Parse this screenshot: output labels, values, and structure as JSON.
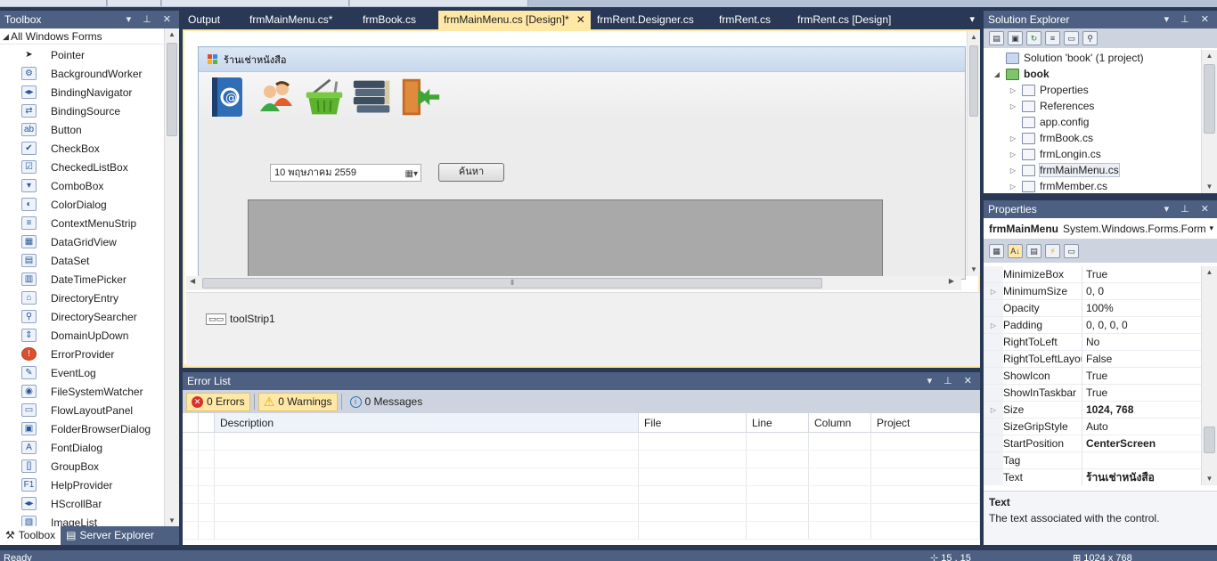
{
  "toolbox": {
    "title": "Toolbox",
    "group": "All Windows Forms",
    "items": [
      {
        "label": "Pointer",
        "icon": "pointer-icon",
        "glyph": "➤"
      },
      {
        "label": "BackgroundWorker",
        "icon": "background-worker-icon",
        "glyph": "⚙"
      },
      {
        "label": "BindingNavigator",
        "icon": "binding-navigator-icon",
        "glyph": "◂▸"
      },
      {
        "label": "BindingSource",
        "icon": "binding-source-icon",
        "glyph": "⇄"
      },
      {
        "label": "Button",
        "icon": "button-icon",
        "glyph": "ab"
      },
      {
        "label": "CheckBox",
        "icon": "checkbox-icon",
        "glyph": "✔"
      },
      {
        "label": "CheckedListBox",
        "icon": "checked-listbox-icon",
        "glyph": "☑"
      },
      {
        "label": "ComboBox",
        "icon": "combobox-icon",
        "glyph": "▾"
      },
      {
        "label": "ColorDialog",
        "icon": "color-dialog-icon",
        "glyph": "◐"
      },
      {
        "label": "ContextMenuStrip",
        "icon": "context-menu-icon",
        "glyph": "≡"
      },
      {
        "label": "DataGridView",
        "icon": "datagridview-icon",
        "glyph": "▦"
      },
      {
        "label": "DataSet",
        "icon": "dataset-icon",
        "glyph": "▤"
      },
      {
        "label": "DateTimePicker",
        "icon": "datetimepicker-icon",
        "glyph": "▥"
      },
      {
        "label": "DirectoryEntry",
        "icon": "directory-entry-icon",
        "glyph": "⌂"
      },
      {
        "label": "DirectorySearcher",
        "icon": "directory-searcher-icon",
        "glyph": "⚲"
      },
      {
        "label": "DomainUpDown",
        "icon": "domain-updown-icon",
        "glyph": "⇕"
      },
      {
        "label": "ErrorProvider",
        "icon": "error-provider-icon",
        "glyph": "!"
      },
      {
        "label": "EventLog",
        "icon": "eventlog-icon",
        "glyph": "✎"
      },
      {
        "label": "FileSystemWatcher",
        "icon": "filesystem-watcher-icon",
        "glyph": "◉"
      },
      {
        "label": "FlowLayoutPanel",
        "icon": "flowlayout-panel-icon",
        "glyph": "▭"
      },
      {
        "label": "FolderBrowserDialog",
        "icon": "folder-browser-icon",
        "glyph": "▣"
      },
      {
        "label": "FontDialog",
        "icon": "font-dialog-icon",
        "glyph": "A"
      },
      {
        "label": "GroupBox",
        "icon": "groupbox-icon",
        "glyph": "[]"
      },
      {
        "label": "HelpProvider",
        "icon": "help-provider-icon",
        "glyph": "F1"
      },
      {
        "label": "HScrollBar",
        "icon": "hscrollbar-icon",
        "glyph": "◂▸"
      },
      {
        "label": "ImageList",
        "icon": "imagelist-icon",
        "glyph": "▧"
      }
    ],
    "bottom_tabs": [
      "Toolbox",
      "Server Explorer"
    ]
  },
  "doc_tabs": [
    {
      "label": "Output"
    },
    {
      "label": "frmMainMenu.cs*"
    },
    {
      "label": "frmBook.cs"
    },
    {
      "label": "frmMainMenu.cs [Design]*",
      "active": true
    },
    {
      "label": "frmRent.Designer.cs"
    },
    {
      "label": "frmRent.cs"
    },
    {
      "label": "frmRent.cs [Design]"
    }
  ],
  "designer": {
    "form_title": "ร้านเช่าหนังสือ",
    "date_value": "10  พฤษภาคม   2559",
    "search_label": "ค้นหา",
    "tray_item": "toolStrip1",
    "toolbar_icons": [
      "address-book-icon",
      "members-icon",
      "basket-icon",
      "books-icon",
      "exit-door-icon"
    ]
  },
  "error_list": {
    "title": "Error List",
    "errors": "0 Errors",
    "warnings": "0 Warnings",
    "messages": "0 Messages",
    "columns": [
      "",
      "",
      "Description",
      "File",
      "Line",
      "Column",
      "Project"
    ]
  },
  "solution_explorer": {
    "title": "Solution Explorer",
    "nodes": [
      {
        "label": "Solution 'book' (1 project)",
        "level": 0,
        "exp": "",
        "icon": "solution-icon"
      },
      {
        "label": "book",
        "level": 1,
        "exp": "◢",
        "icon": "csharp-project-icon",
        "bold": true
      },
      {
        "label": "Properties",
        "level": 2,
        "exp": "▷",
        "icon": "properties-folder-icon"
      },
      {
        "label": "References",
        "level": 2,
        "exp": "▷",
        "icon": "references-folder-icon"
      },
      {
        "label": "app.config",
        "level": 2,
        "exp": "",
        "icon": "config-file-icon"
      },
      {
        "label": "frmBook.cs",
        "level": 2,
        "exp": "▷",
        "icon": "form-file-icon"
      },
      {
        "label": "frmLongin.cs",
        "level": 2,
        "exp": "▷",
        "icon": "form-file-icon"
      },
      {
        "label": "frmMainMenu.cs",
        "level": 2,
        "exp": "▷",
        "icon": "form-file-icon",
        "selected": true
      },
      {
        "label": "frmMember.cs",
        "level": 2,
        "exp": "▷",
        "icon": "form-file-icon"
      }
    ]
  },
  "properties": {
    "title": "Properties",
    "object_name": "frmMainMenu",
    "object_type": "System.Windows.Forms.Form",
    "rows": [
      {
        "name": "MinimizeBox",
        "value": "True",
        "exp": ""
      },
      {
        "name": "MinimumSize",
        "value": "0, 0",
        "exp": "▷"
      },
      {
        "name": "Opacity",
        "value": "100%",
        "exp": ""
      },
      {
        "name": "Padding",
        "value": "0, 0, 0, 0",
        "exp": "▷"
      },
      {
        "name": "RightToLeft",
        "value": "No",
        "exp": ""
      },
      {
        "name": "RightToLeftLayout",
        "value": "False",
        "exp": ""
      },
      {
        "name": "ShowIcon",
        "value": "True",
        "exp": ""
      },
      {
        "name": "ShowInTaskbar",
        "value": "True",
        "exp": ""
      },
      {
        "name": "Size",
        "value": "1024, 768",
        "exp": "▷",
        "bold": true
      },
      {
        "name": "SizeGripStyle",
        "value": "Auto",
        "exp": ""
      },
      {
        "name": "StartPosition",
        "value": "CenterScreen",
        "exp": "",
        "bold": true
      },
      {
        "name": "Tag",
        "value": "",
        "exp": ""
      },
      {
        "name": "Text",
        "value": "ร้านเช่าหนังสือ",
        "exp": "",
        "bold": true
      }
    ],
    "desc_title": "Text",
    "desc_text": "The text associated with the control."
  },
  "status": {
    "left": "Ready",
    "position": "15 , 15",
    "size": "1024 x 768"
  },
  "colors": {
    "ide_dark": "#293955",
    "pane_title": "#4d6082",
    "active_tab": "#ffe8a6",
    "grid_gray": "#a9a9a9"
  }
}
